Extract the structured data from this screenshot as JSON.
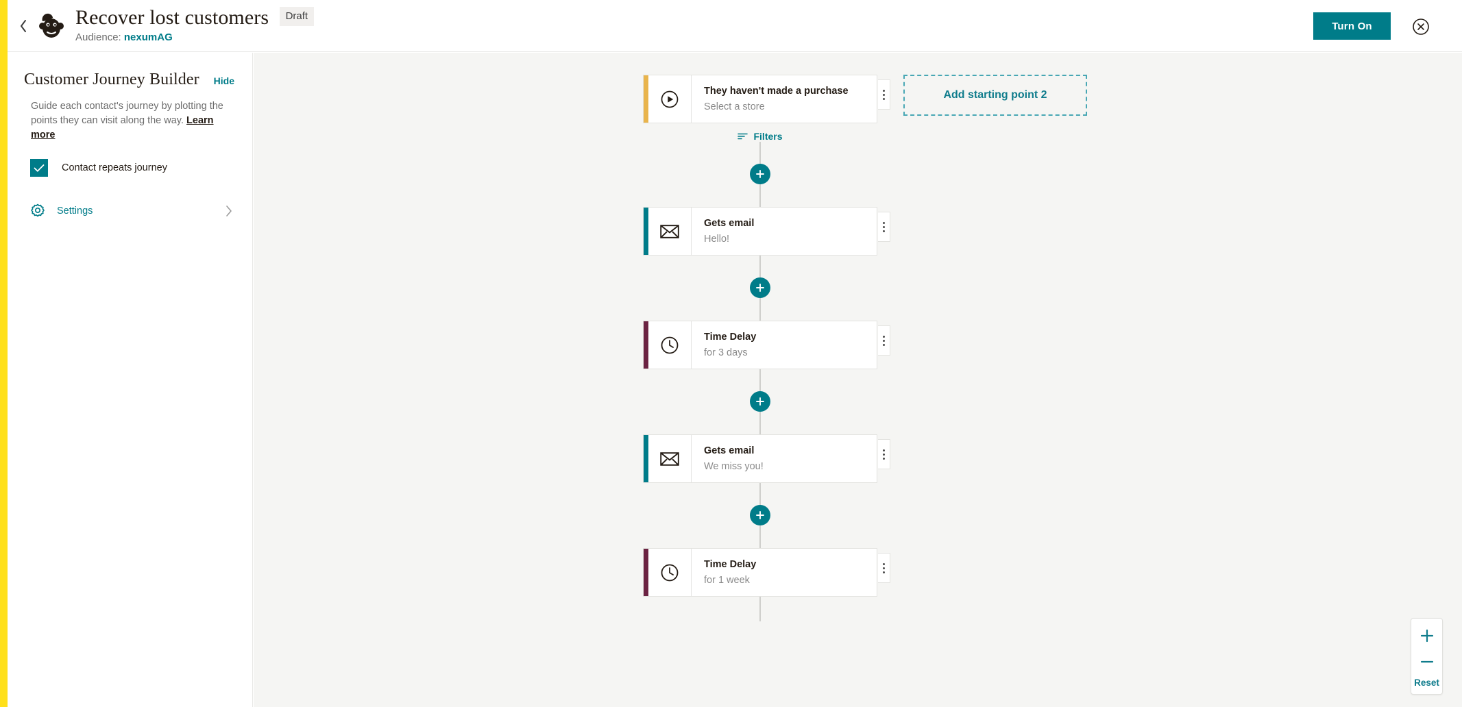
{
  "topbar": {
    "back_icon": "chevron-left-icon",
    "logo": "mailchimp-logo",
    "title": "Recover lost customers",
    "status_badge": "Draft",
    "audience_prefix": "Audience:",
    "audience_name": "nexumAG",
    "turn_on_label": "Turn On",
    "close_icon": "close-circle-icon",
    "accent_color": "#007c89",
    "strip_color": "#ffe01b"
  },
  "sidebar": {
    "title": "Customer Journey Builder",
    "hide_label": "Hide",
    "description": "Guide each contact's journey by plotting the points they can visit along the way.",
    "learn_more_label": "Learn more",
    "repeat_checkbox_label": "Contact repeats journey",
    "repeat_checked": true,
    "settings_label": "Settings",
    "settings_icon": "gear-icon",
    "chevron_icon": "chevron-right-icon"
  },
  "canvas": {
    "background": "#f5f5f3",
    "add_starting_point_label": "Add starting point 2",
    "filters_label": "Filters",
    "filters_icon": "filter-icon",
    "plus_icon": "plus-icon",
    "nodes": [
      {
        "type": "trigger",
        "icon": "play-circle-icon",
        "accent": "#e9b44c",
        "title": "They haven't made a purchase",
        "subtitle": "Select a store",
        "menu_icon": "kebab-menu-icon"
      },
      {
        "type": "email",
        "icon": "envelope-icon",
        "accent": "#007c89",
        "title": "Gets email",
        "subtitle": "Hello!",
        "menu_icon": "kebab-menu-icon"
      },
      {
        "type": "delay",
        "icon": "clock-icon",
        "accent": "#6b2342",
        "title": "Time Delay",
        "subtitle": "for 3 days",
        "menu_icon": "kebab-menu-icon"
      },
      {
        "type": "email",
        "icon": "envelope-icon",
        "accent": "#007c89",
        "title": "Gets email",
        "subtitle": "We miss you!",
        "menu_icon": "kebab-menu-icon"
      },
      {
        "type": "delay",
        "icon": "clock-icon",
        "accent": "#6b2342",
        "title": "Time Delay",
        "subtitle": "for 1 week",
        "menu_icon": "kebab-menu-icon"
      }
    ]
  },
  "zoom_controls": {
    "zoom_in_label": "+",
    "zoom_out_label": "−",
    "reset_label": "Reset"
  }
}
